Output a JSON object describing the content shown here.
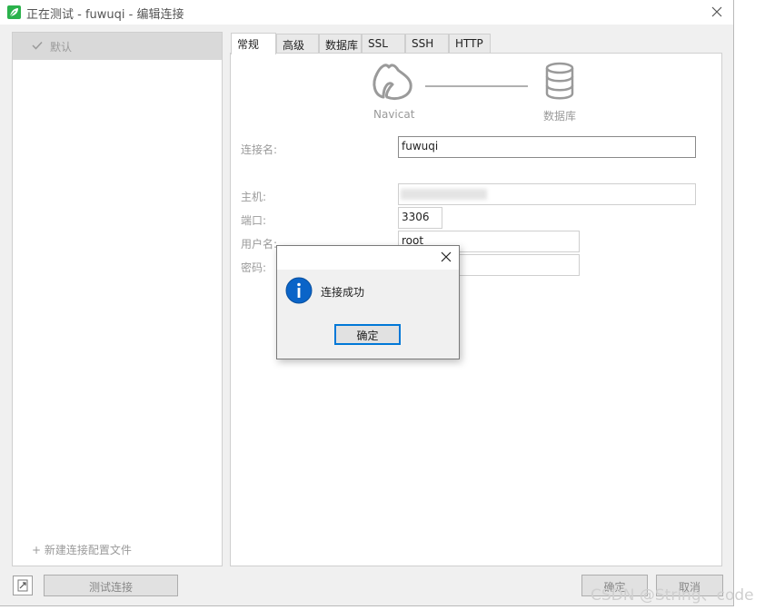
{
  "window": {
    "title": "正在测试 - fuwuqi - 编辑连接",
    "close_icon": "close-icon",
    "app_icon": "navicat-leaf-icon",
    "accent_color": "#2bb24c"
  },
  "sidebar": {
    "items": [
      {
        "label": "默认",
        "icon": "check-icon",
        "selected": true
      }
    ],
    "new_profile_label": "+ 新建连接配置文件"
  },
  "tabs": [
    {
      "label": "常规",
      "active": true
    },
    {
      "label": "高级",
      "active": false
    },
    {
      "label": "数据库",
      "active": false
    },
    {
      "label": "SSL",
      "active": false
    },
    {
      "label": "SSH",
      "active": false
    },
    {
      "label": "HTTP",
      "active": false
    }
  ],
  "graphic": {
    "left_caption": "Navicat",
    "right_caption": "数据库",
    "left_icon": "navicat-logo-icon",
    "right_icon": "database-icon"
  },
  "form": {
    "connection_name": {
      "label": "连接名:",
      "value": "fuwuqi"
    },
    "host": {
      "label": "主机:",
      "value": ""
    },
    "port": {
      "label": "端口:",
      "value": "3306"
    },
    "username": {
      "label": "用户名:",
      "value": "root"
    },
    "password": {
      "label": "密码:",
      "value": ""
    }
  },
  "footer": {
    "test_button": "测试连接",
    "ok_button": "确定",
    "cancel_button": "取消"
  },
  "dialog": {
    "message": "连接成功",
    "ok_button": "确定",
    "icon": "info-icon",
    "icon_color": "#0a64c8"
  },
  "watermark": "CSDN @String、code"
}
